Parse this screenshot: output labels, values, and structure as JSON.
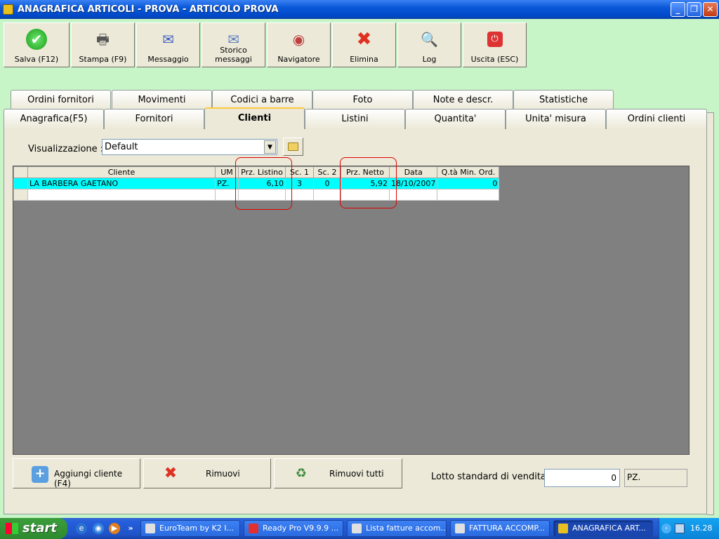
{
  "window": {
    "title": "ANAGRAFICA ARTICOLI - PROVA - ARTICOLO PROVA",
    "minimize": "_",
    "maximize": "❐",
    "close": "✕"
  },
  "toolbar": [
    {
      "label": "Salva (F12)",
      "icon": "check-icon",
      "glyph": "✔"
    },
    {
      "label": "Stampa (F9)",
      "icon": "printer-icon",
      "glyph": "🖶"
    },
    {
      "label": "Messaggio",
      "icon": "message-icon",
      "glyph": "✉"
    },
    {
      "label": "Storico messaggi",
      "icon": "message-history-icon",
      "glyph": "✉"
    },
    {
      "label": "Navigatore",
      "icon": "compass-icon",
      "glyph": "◉"
    },
    {
      "label": "Elimina",
      "icon": "delete-icon",
      "glyph": "✖"
    },
    {
      "label": "Log",
      "icon": "log-search-icon",
      "glyph": "🔍"
    },
    {
      "label": "Uscita (ESC)",
      "icon": "exit-icon",
      "glyph": "⏻"
    }
  ],
  "tabs_back": [
    "Ordini fornitori",
    "Movimenti",
    "Codici a barre",
    "Foto",
    "Note e descr.",
    "Statistiche"
  ],
  "tabs_front": [
    "Anagrafica(F5)",
    "Fornitori",
    "Clienti",
    "Listini",
    "Quantita'",
    "Unita' misura",
    "Ordini clienti"
  ],
  "active_tab": "Clienti",
  "view": {
    "label": "Visualizzazione :",
    "value": "Default",
    "arrow": "▼"
  },
  "grid": {
    "columns": [
      "Cliente",
      "UM",
      "Prz. Listino",
      "Sc. 1",
      "Sc. 2",
      "Prz. Netto",
      "Data",
      "Q.tà Min. Ord."
    ],
    "rows": [
      {
        "cliente": "LA BARBERA GAETANO",
        "um": "PZ.",
        "prz_listino": "6,10",
        "sc1": "3",
        "sc2": "0",
        "prz_netto": "5,92",
        "data": "18/10/2007",
        "qta_min": "0"
      }
    ]
  },
  "buttons": {
    "add": "Aggiungi cliente (F4)",
    "remove": "Rimuovi",
    "remove_all": "Rimuovi tutti",
    "add_glyph": "+",
    "remove_glyph": "✖",
    "remove_all_glyph": "♻"
  },
  "lotto": {
    "label": "Lotto standard di vendita :",
    "value": "0",
    "unit": "PZ."
  },
  "taskbar": {
    "start": "start",
    "quicklaunch": [
      "e",
      "◉",
      "▶"
    ],
    "overflow": "»",
    "tasks": [
      "EuroTeam by K2 I...",
      "Ready Pro V9.9.9 ...",
      "Lista fatture accom...",
      "FATTURA ACCOMP...",
      "ANAGRAFICA ART..."
    ],
    "clock": "16.28",
    "tray_arrow": "‹"
  }
}
